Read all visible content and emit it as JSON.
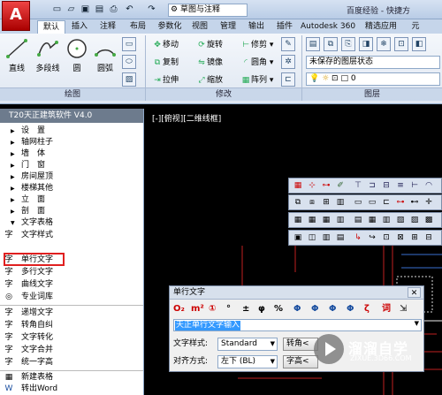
{
  "titlebar": {
    "app_letter": "A",
    "workspace": "草图与注释",
    "search": "百度经验 - 快捷方"
  },
  "tabs": [
    "默认",
    "插入",
    "注释",
    "布局",
    "参数化",
    "视图",
    "管理",
    "输出",
    "插件",
    "Autodesk 360",
    "精选应用",
    "元"
  ],
  "ribbon": {
    "draw_tools": [
      "直线",
      "多段线",
      "圆",
      "圆弧"
    ],
    "modify_tools": [
      {
        "glyph": "✥",
        "label": "移动"
      },
      {
        "glyph": "⟳",
        "label": "旋转"
      },
      {
        "glyph": "⊢",
        "label": "修剪"
      },
      {
        "glyph": "⧉",
        "label": "复制"
      },
      {
        "glyph": "⇋",
        "label": "镜像"
      },
      {
        "glyph": "◜",
        "label": "圆角"
      },
      {
        "glyph": "⇥",
        "label": "拉伸"
      },
      {
        "glyph": "⤢",
        "label": "缩放"
      },
      {
        "glyph": "▦",
        "label": "阵列"
      }
    ],
    "layer_state": "未保存的图层状态",
    "layer_value": "0",
    "groups": [
      "绘图",
      "修改",
      "图层"
    ]
  },
  "left_panel": {
    "title": "T20天正建筑软件 V4.0",
    "categories": [
      "设　置",
      "轴网柱子",
      "墙　体",
      "门　窗",
      "房间屋顶",
      "楼梯其他",
      "立　面",
      "剖　面",
      "文字表格"
    ],
    "sub_items": [
      {
        "icon": "字",
        "label": "文字样式"
      },
      {
        "icon": "字",
        "label": "单行文字"
      },
      {
        "icon": "字",
        "label": "多行文字"
      },
      {
        "icon": "字",
        "label": "曲线文字"
      },
      {
        "icon": "◎",
        "label": "专业词库"
      },
      {
        "icon": "字",
        "label": "递增文字"
      },
      {
        "icon": "字",
        "label": "转角自纠"
      },
      {
        "icon": "字",
        "label": "文字转化"
      },
      {
        "icon": "字",
        "label": "文字合并"
      },
      {
        "icon": "字",
        "label": "统一字高"
      },
      {
        "icon": "▦",
        "label": "新建表格"
      },
      {
        "icon": "W",
        "label": "转出Word"
      }
    ]
  },
  "viewport": {
    "label": "[-][俯视][二维线框]"
  },
  "dialog": {
    "title": "单行文字",
    "close": "✕",
    "symbols": [
      "O₂",
      "m²",
      "①",
      "°",
      "±",
      "φ",
      "%",
      "Φ",
      "Φ",
      "Φ",
      "Φ",
      "ζ",
      "词",
      "⇲"
    ],
    "input_value": "天正单行文字输入",
    "style_label": "文字样式:",
    "style_value": "Standard",
    "angle_btn": "转角<",
    "align_label": "对齐方式:",
    "align_value": "左下 (BL)",
    "height_btn": "字高<"
  },
  "watermark": {
    "title": "溜溜自学",
    "sub": "ZIXUE.3D66.COM"
  },
  "colors": {
    "accent_red": "#e02020",
    "viewport_bg": "#000000",
    "selection": "#3399ff"
  }
}
